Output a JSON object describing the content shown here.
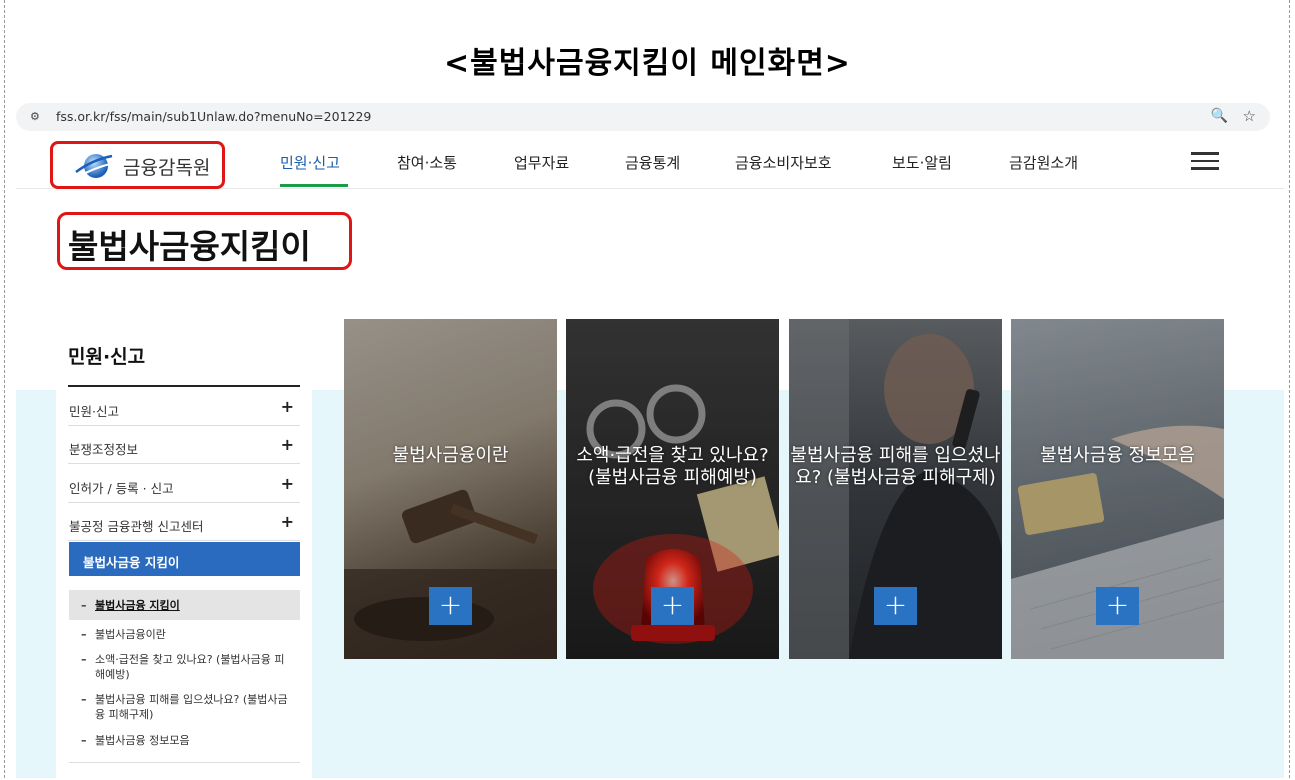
{
  "caption": "<불법사금융지킴이 메인화면>",
  "browser": {
    "url": "fss.or.kr/fss/main/sub1Unlaw.do?menuNo=201229",
    "tune_icon": "site-settings-icon",
    "zoom_icon": "zoom-icon",
    "star_icon": "bookmark-star-icon"
  },
  "site": {
    "logo_text": "금융감독원",
    "nav": [
      "민원·신고",
      "참여·소통",
      "업무자료",
      "금융통계",
      "금융소비자보호",
      "보도·알림",
      "금감원소개"
    ],
    "active_nav": "민원·신고"
  },
  "page_title": "불법사금융지킴이",
  "sidebar": {
    "title": "민원·신고",
    "items": [
      {
        "label": "민원·신고",
        "toggle": "+"
      },
      {
        "label": "분쟁조정정보",
        "toggle": "+"
      },
      {
        "label": "인허가 / 등록 · 신고",
        "toggle": "+"
      },
      {
        "label": "불공정 금융관행 신고센터",
        "toggle": "+"
      }
    ],
    "active": "불법사금융 지킴이",
    "sub_bullet": "–",
    "sub_items": [
      "불법사금융 지킴이",
      "불법사금융이란",
      "소액·급전을 찾고 있나요? (불법사금융 피해예방)",
      "불법사금융 피해를 입으셨나요? (불법사금융 피해구제)",
      "불법사금융 정보모음"
    ]
  },
  "cards": [
    {
      "text": "불법사금융이란",
      "button": "+"
    },
    {
      "text": "소액·급전을 찾고 있나요? (불법사금융 피해예방)",
      "button": "+"
    },
    {
      "text": "불법사금융 피해를 입으셨나요? (불법사금융 피해구제)",
      "button": "+"
    },
    {
      "text": "불법사금융 정보모음",
      "button": "+"
    }
  ],
  "colors": {
    "highlight": "#e01515",
    "accent_blue": "#2a6bbf",
    "nav_underline": "#1a9b49",
    "band": "#e6f7fb"
  }
}
